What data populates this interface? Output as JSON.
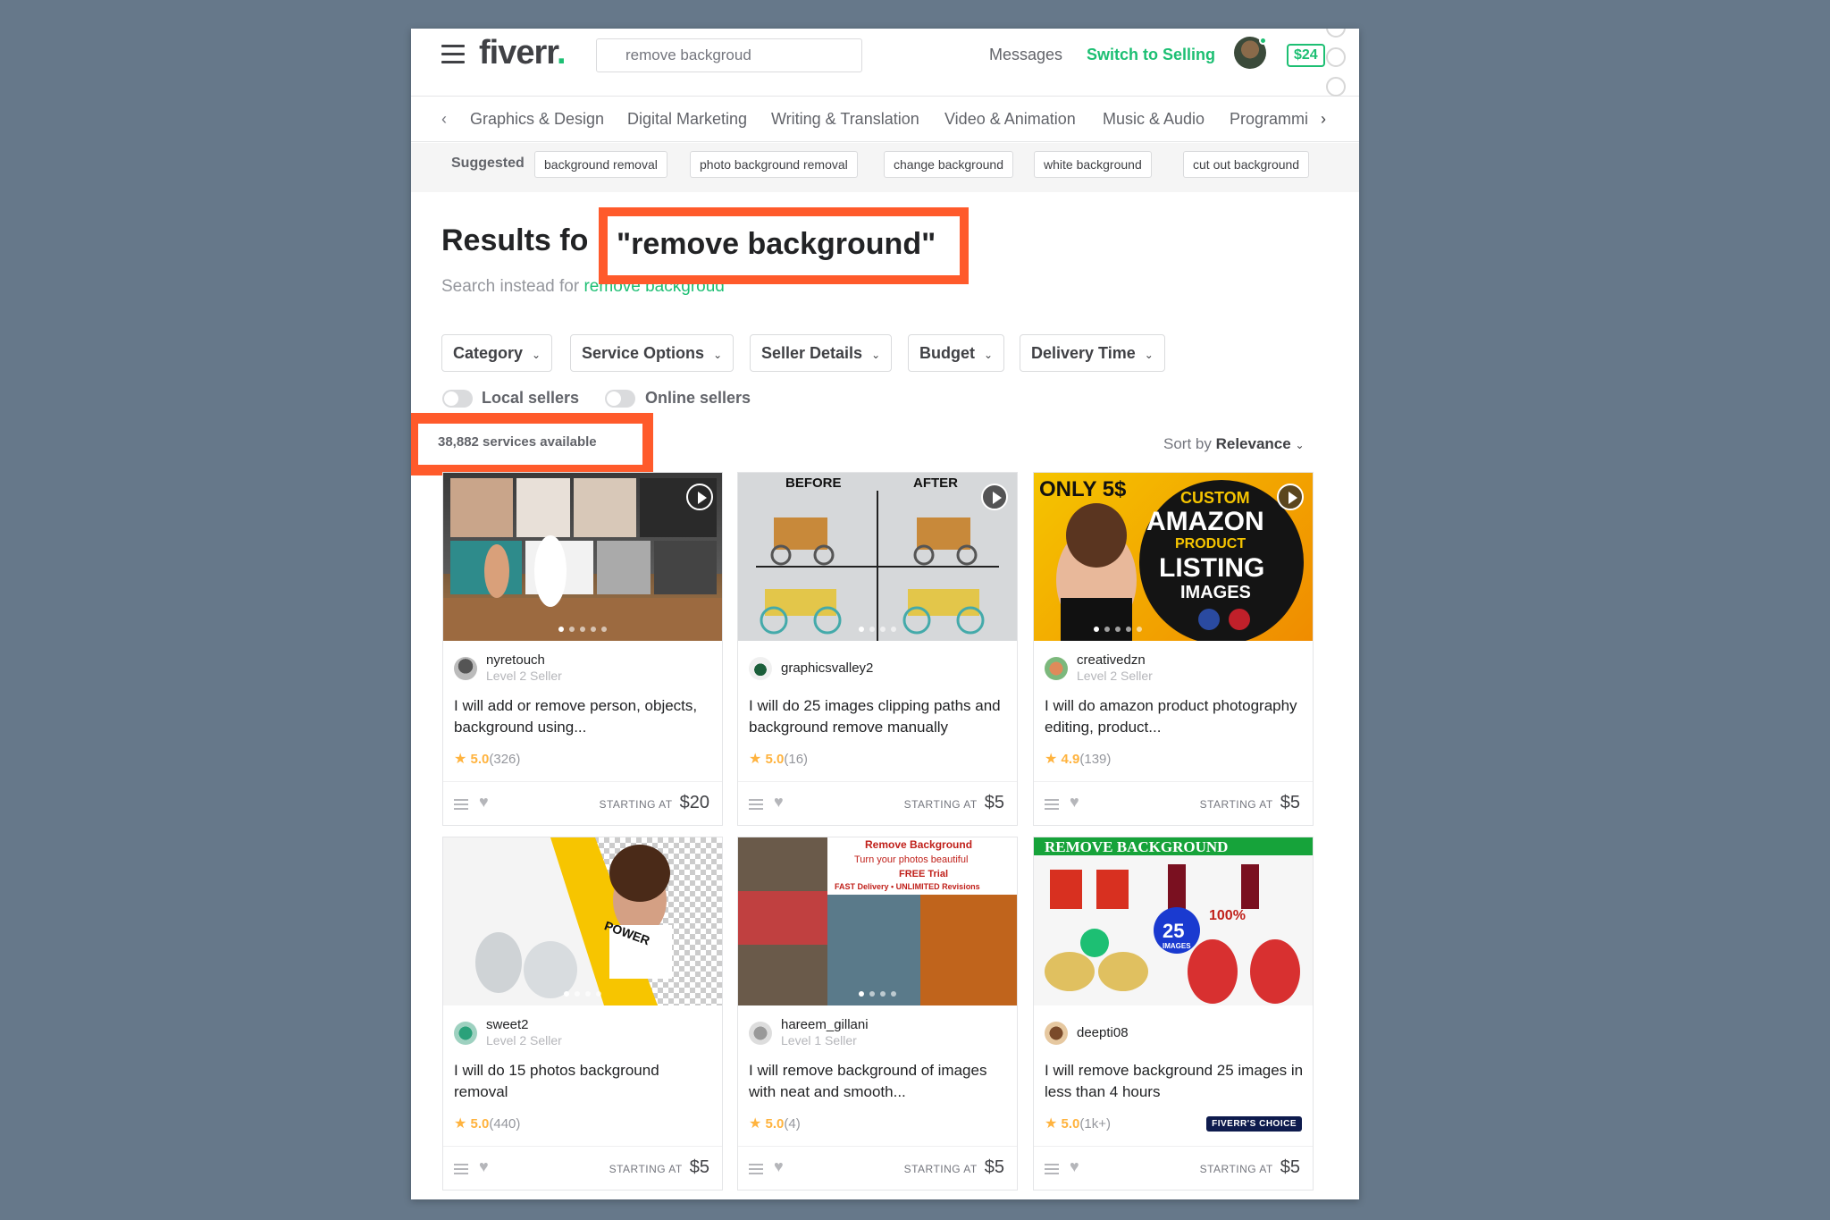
{
  "header": {
    "logo": "fiverr",
    "logo_dot": ".",
    "search_value": "remove backgroud",
    "messages": "Messages",
    "switch": "Switch to Selling",
    "balance": "$24"
  },
  "categories": [
    "Graphics & Design",
    "Digital Marketing",
    "Writing & Translation",
    "Video & Animation",
    "Music & Audio",
    "Programmi"
  ],
  "suggested": {
    "label": "Suggested",
    "chips": [
      "background removal",
      "photo background removal",
      "change background",
      "white background",
      "cut out background"
    ]
  },
  "results": {
    "prefix": "Results fo",
    "query": "\"remove background\"",
    "instead_prefix": "Search instead for",
    "instead_link": "remove backgroud"
  },
  "filters": [
    "Category",
    "Service Options",
    "Seller Details",
    "Budget",
    "Delivery Time"
  ],
  "toggles": [
    "Local sellers",
    "Online sellers"
  ],
  "services_available": "38,882 services available",
  "sort": {
    "label": "Sort by",
    "value": "Relevance"
  },
  "gigs": [
    {
      "seller": "nyretouch",
      "level": "Level 2 Seller",
      "title": "I will add or remove person, objects, background using...",
      "score": "5.0",
      "count": "(326)",
      "starting": "STARTING AT",
      "price": "$20"
    },
    {
      "seller": "graphicsvalley2",
      "level": "",
      "title": "I will do 25 images clipping paths and background remove manually",
      "score": "5.0",
      "count": "(16)",
      "starting": "STARTING AT",
      "price": "$5",
      "thumb_before": "BEFORE",
      "thumb_after": "AFTER"
    },
    {
      "seller": "creativedzn",
      "level": "Level 2 Seller",
      "title": "I will do amazon product photography editing, product...",
      "score": "4.9",
      "count": "(139)",
      "starting": "STARTING AT",
      "price": "$5",
      "thumb_l1": "ONLY 5$",
      "thumb_l2": "CUSTOM",
      "thumb_l3": "AMAZON",
      "thumb_l4": "PRODUCT",
      "thumb_l5": "LISTING",
      "thumb_l6": "IMAGES"
    },
    {
      "seller": "sweet2",
      "level": "Level 2 Seller",
      "title": "I will do 15 photos background removal",
      "score": "5.0",
      "count": "(440)",
      "starting": "STARTING AT",
      "price": "$5",
      "thumb_shirt": "POWER"
    },
    {
      "seller": "hareem_gillani",
      "level": "Level 1 Seller",
      "title": "I will remove background of images with neat and smooth...",
      "score": "5.0",
      "count": "(4)",
      "starting": "STARTING AT",
      "price": "$5",
      "thumb_l1": "Remove Background",
      "thumb_l2": "Turn your photos beautiful",
      "thumb_l3": "FREE Trial",
      "thumb_l4": "FAST Delivery • UNLIMITED Revisions"
    },
    {
      "seller": "deepti08",
      "level": "",
      "title": "I will remove background 25 images in less than 4 hours",
      "score": "5.0",
      "count": "(1k+)",
      "starting": "STARTING AT",
      "price": "$5",
      "badge": "FIVERR'S CHOICE",
      "thumb_banner": "REMOVE BACKGROUND",
      "thumb_num": "25",
      "thumb_sub": "IMAGES",
      "thumb_pct": "100%"
    }
  ]
}
